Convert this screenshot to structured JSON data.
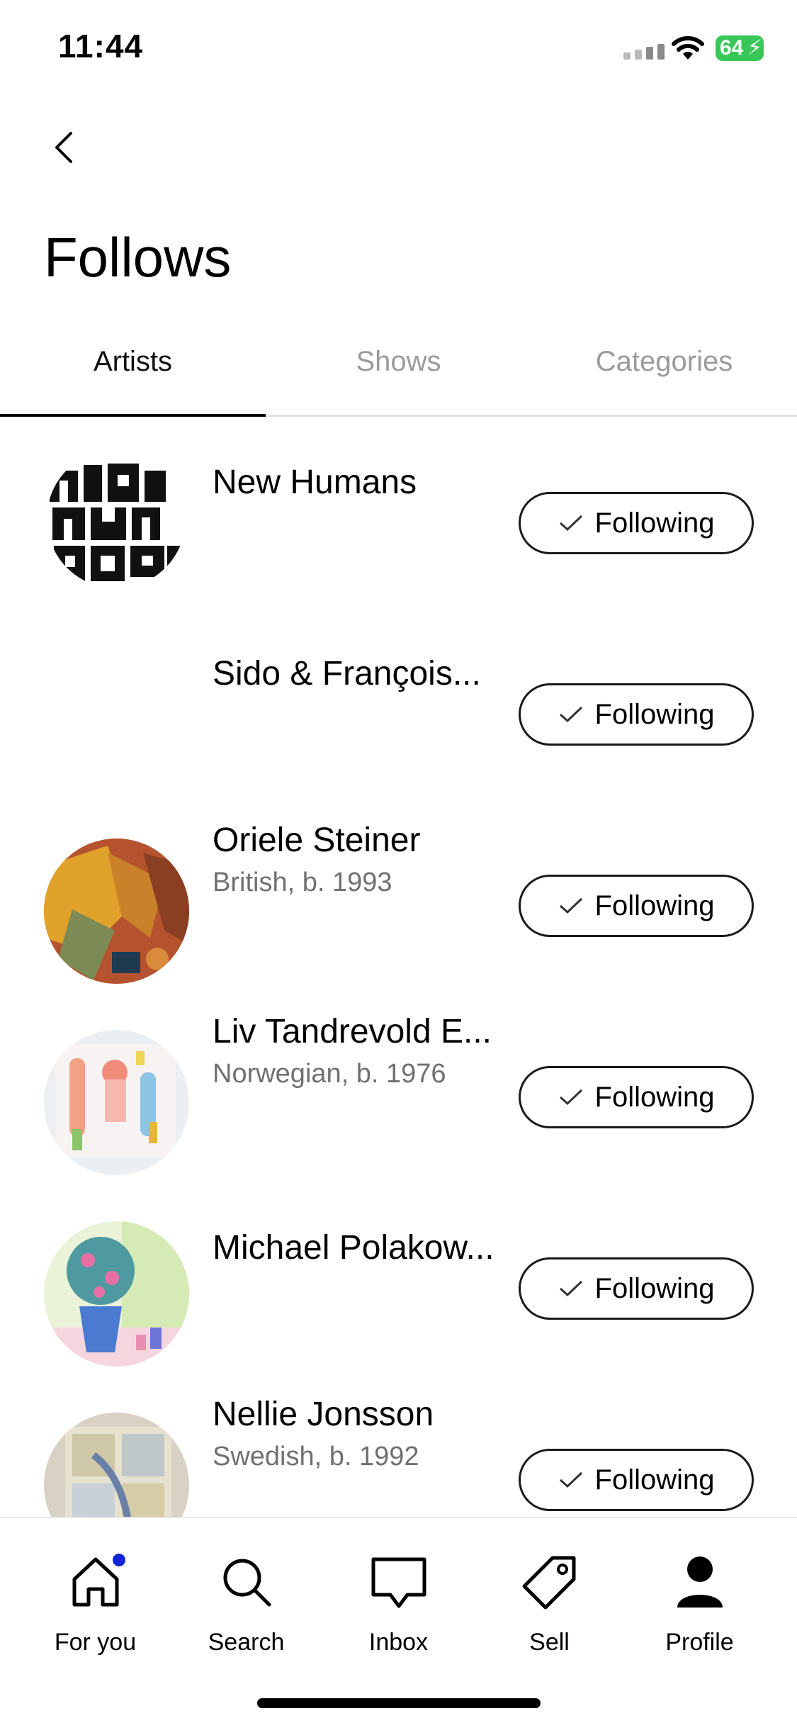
{
  "status_bar": {
    "time": "11:44",
    "battery": "64"
  },
  "header": {
    "back_icon": "chevron-left-icon",
    "title": "Follows"
  },
  "tabs": [
    {
      "label": "Artists",
      "active": true
    },
    {
      "label": "Shows",
      "active": false
    },
    {
      "label": "Categories",
      "active": false
    }
  ],
  "artists": [
    {
      "name": "New Humans",
      "meta": "",
      "button": "Following"
    },
    {
      "name": "Sido & François...",
      "meta": "",
      "button": "Following"
    },
    {
      "name": "Oriele Steiner",
      "meta": "British, b. 1993",
      "button": "Following"
    },
    {
      "name": "Liv Tandrevold E...",
      "meta": "Norwegian, b. 1976",
      "button": "Following"
    },
    {
      "name": "Michael Polakow...",
      "meta": "",
      "button": "Following"
    },
    {
      "name": "Nellie Jonsson",
      "meta": "Swedish, b. 1992",
      "button": "Following"
    }
  ],
  "bottom_nav": [
    {
      "label": "For you",
      "icon": "home-icon",
      "badge": true
    },
    {
      "label": "Search",
      "icon": "search-icon",
      "badge": false
    },
    {
      "label": "Inbox",
      "icon": "inbox-icon",
      "badge": false
    },
    {
      "label": "Sell",
      "icon": "tag-icon",
      "badge": false
    },
    {
      "label": "Profile",
      "icon": "profile-icon",
      "badge": false
    }
  ],
  "colors": {
    "accent_dot": "#1023d7",
    "battery": "#38c759",
    "muted_text": "#707070",
    "inactive_tab": "#9b9b9b"
  }
}
